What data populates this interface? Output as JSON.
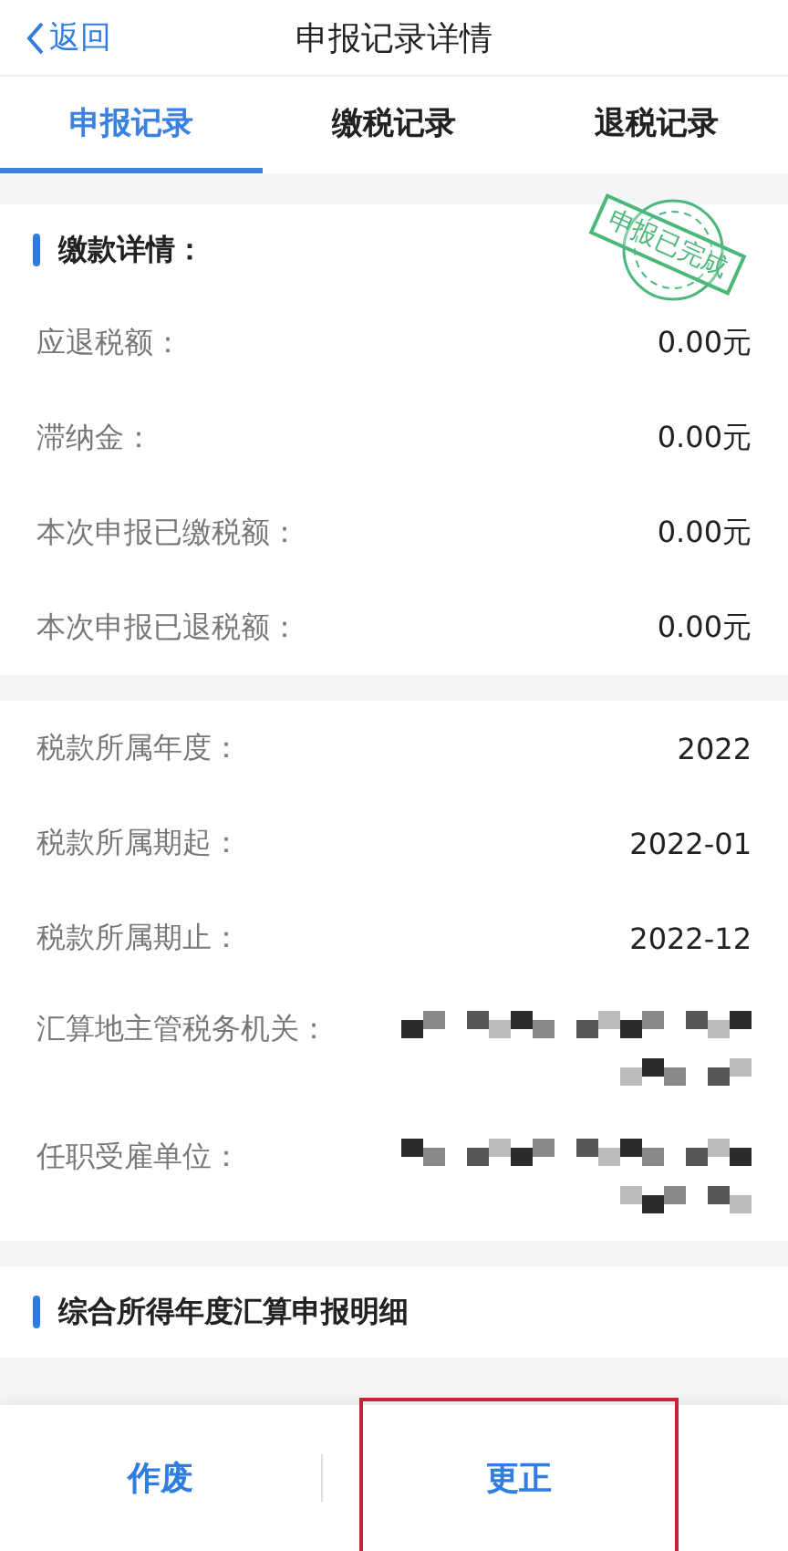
{
  "nav": {
    "back": "返回",
    "title": "申报记录详情"
  },
  "tabs": [
    {
      "label": "申报记录",
      "selected": true
    },
    {
      "label": "缴税记录",
      "selected": false
    },
    {
      "label": "退税记录",
      "selected": false
    }
  ],
  "payment_section": {
    "title": "缴款详情：",
    "stamp": "申报已完成",
    "rows": [
      {
        "label": "应退税额：",
        "value": "0.00元"
      },
      {
        "label": "滞纳金：",
        "value": "0.00元"
      },
      {
        "label": "本次申报已缴税额：",
        "value": "0.00元"
      },
      {
        "label": "本次申报已退税额：",
        "value": "0.00元"
      }
    ]
  },
  "info_section": {
    "rows": [
      {
        "kind": "text",
        "label": "税款所属年度：",
        "value": "2022"
      },
      {
        "kind": "text",
        "label": "税款所属期起：",
        "value": "2022-01"
      },
      {
        "kind": "text",
        "label": "税款所属期止：",
        "value": "2022-12"
      },
      {
        "kind": "pixelated",
        "label": "汇算地主管税务机关："
      },
      {
        "kind": "pixelated",
        "label": "任职受雇单位："
      }
    ]
  },
  "detail_section": {
    "title": "综合所得年度汇算申报明细"
  },
  "buttons": [
    {
      "label": "作废",
      "highlighted": false
    },
    {
      "label": "更正",
      "highlighted": true
    }
  ]
}
